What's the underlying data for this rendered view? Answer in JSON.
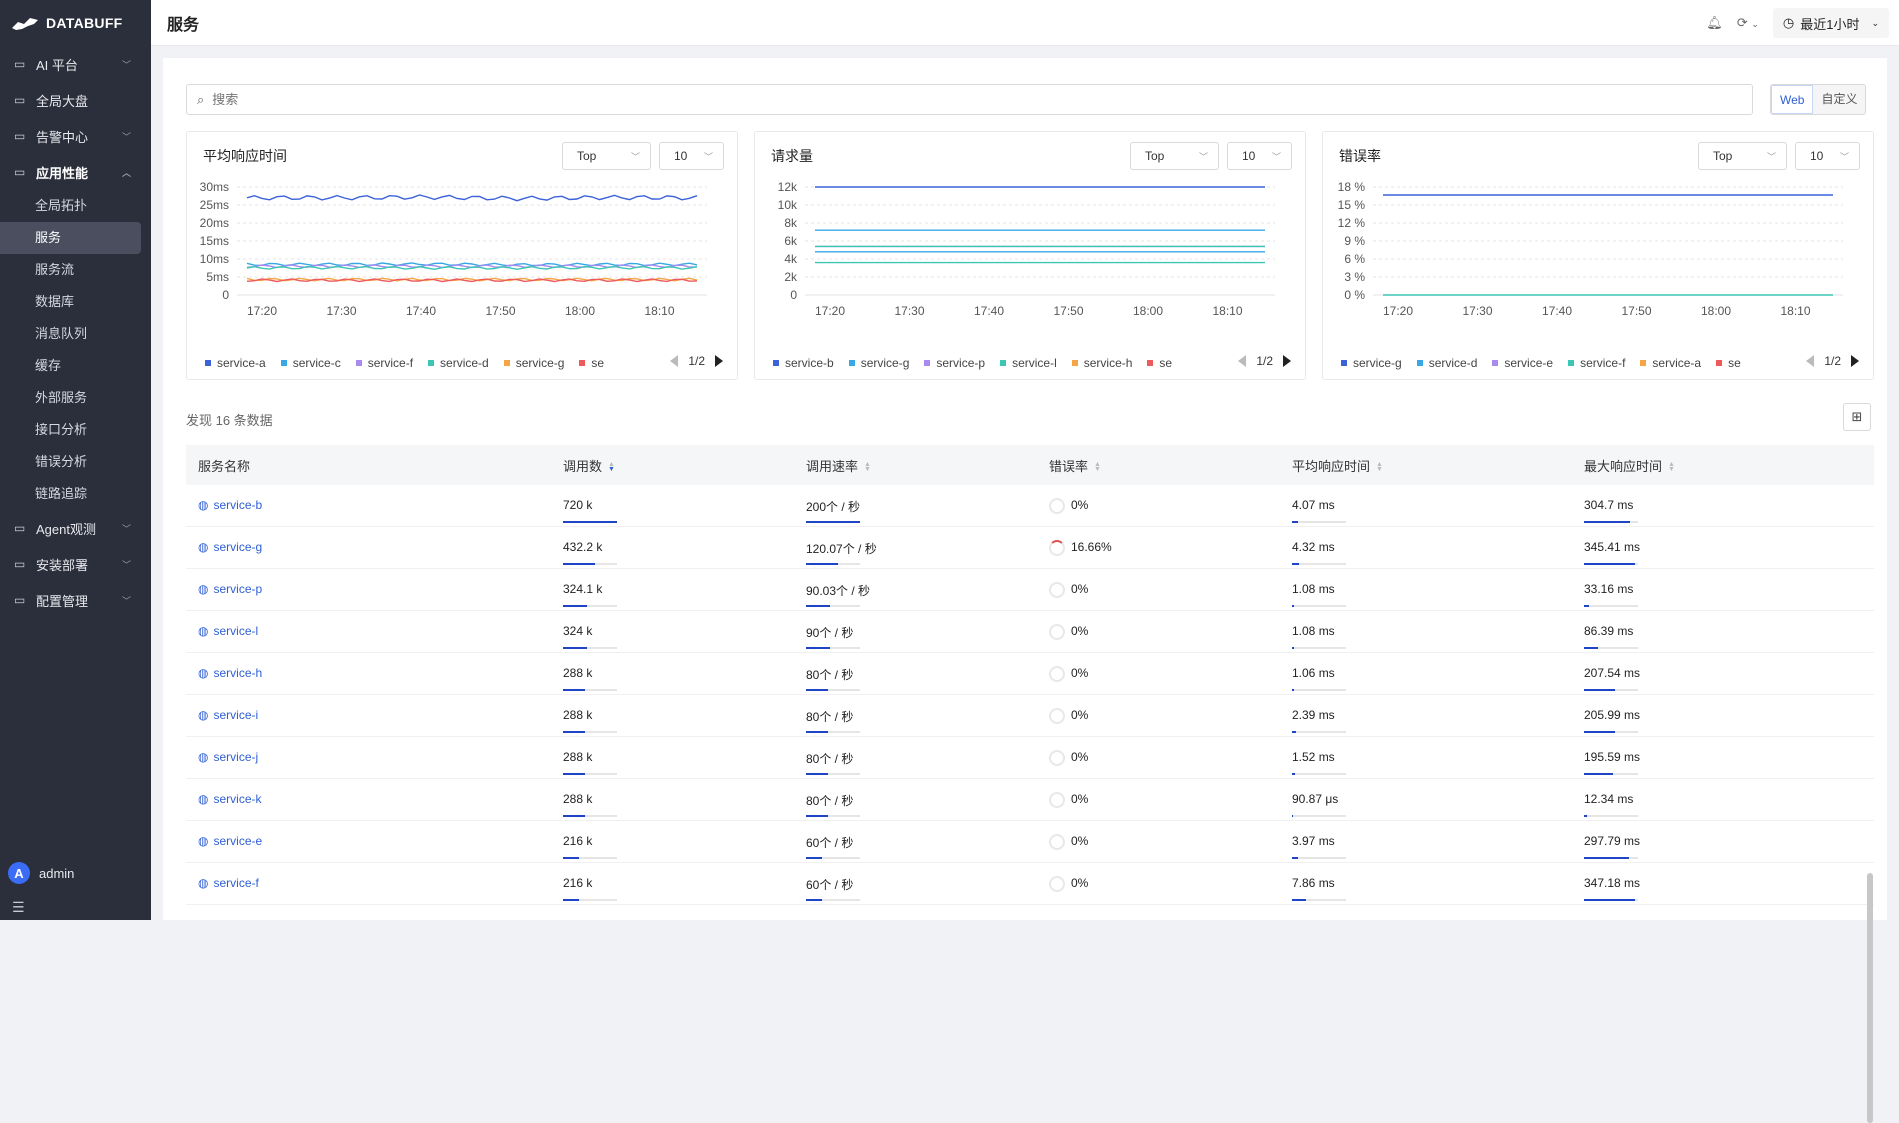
{
  "sidebar": {
    "logo": "DATABUFF",
    "groups": [
      {
        "label": "AI 平台",
        "icon": "ai-platform-icon"
      },
      {
        "label": "全局大盘",
        "icon": "dashboard-icon"
      },
      {
        "label": "告警中心",
        "icon": "alarm-icon"
      },
      {
        "label": "应用性能",
        "icon": "apm-icon"
      }
    ],
    "sub_items": [
      "全局拓扑",
      "服务",
      "服务流",
      "数据库",
      "消息队列",
      "缓存",
      "外部服务",
      "接口分析",
      "错误分析",
      "链路追踪"
    ],
    "selected_sub": "服务",
    "groups_after": [
      {
        "label": "Agent观测",
        "icon": "agent-icon"
      },
      {
        "label": "安装部署",
        "icon": "install-icon"
      },
      {
        "label": "配置管理",
        "icon": "config-icon"
      }
    ],
    "user": {
      "initial": "A",
      "name": "admin"
    }
  },
  "header": {
    "title": "服务",
    "time_range": "最近1小时"
  },
  "search": {
    "placeholder": "搜索"
  },
  "view_toggle": {
    "options": [
      "Web",
      "自定义"
    ],
    "selected": "Web"
  },
  "panels": [
    {
      "title": "平均响应时间",
      "select_top": "Top",
      "select_n": "10",
      "legend": [
        "service-a",
        "service-c",
        "service-f",
        "service-d",
        "service-g",
        "se"
      ],
      "legend_colors": [
        "#3b62d8",
        "#37a7e6",
        "#a98bf0",
        "#3cc6b3",
        "#f5a546",
        "#ee5a5a"
      ],
      "page": "1/2"
    },
    {
      "title": "请求量",
      "select_top": "Top",
      "select_n": "10",
      "legend": [
        "service-b",
        "service-g",
        "service-p",
        "service-l",
        "service-h",
        "se"
      ],
      "legend_colors": [
        "#3b62d8",
        "#37a7e6",
        "#a98bf0",
        "#3cc6b3",
        "#f5a546",
        "#ee5a5a"
      ],
      "page": "1/2"
    },
    {
      "title": "错误率",
      "select_top": "Top",
      "select_n": "10",
      "legend": [
        "service-g",
        "service-d",
        "service-e",
        "service-f",
        "service-a",
        "se"
      ],
      "legend_colors": [
        "#3b62d8",
        "#37a7e6",
        "#a98bf0",
        "#3cc6b3",
        "#f5a546",
        "#ee5a5a"
      ],
      "page": "1/2"
    }
  ],
  "chart_data": [
    {
      "type": "line",
      "title": "平均响应时间",
      "x": [
        "17:20",
        "17:30",
        "17:40",
        "17:50",
        "18:00",
        "18:10"
      ],
      "y_ticks": [
        "0",
        "5ms",
        "10ms",
        "15ms",
        "20ms",
        "25ms",
        "30ms"
      ],
      "ylim": [
        0,
        30
      ],
      "series": [
        {
          "name": "service-a",
          "color": "#3b62d8",
          "values": [
            27,
            27,
            27.2,
            26.8,
            27.1,
            27
          ]
        },
        {
          "name": "service-c",
          "color": "#37a7e6",
          "values": [
            8.5,
            8.5,
            8.6,
            8.4,
            8.5,
            8.5
          ]
        },
        {
          "name": "service-f",
          "color": "#a98bf0",
          "values": [
            8,
            8,
            8,
            8,
            8,
            8
          ]
        },
        {
          "name": "service-d",
          "color": "#3cc6b3",
          "values": [
            7.5,
            7.6,
            7.5,
            7.5,
            7.6,
            7.5
          ]
        },
        {
          "name": "service-g",
          "color": "#f5a546",
          "values": [
            4.3,
            4.3,
            4.3,
            4.3,
            4.3,
            4.3
          ]
        },
        {
          "name": "se",
          "color": "#ee5a5a",
          "values": [
            4.1,
            4.1,
            4.1,
            4.1,
            4.1,
            4.1
          ]
        }
      ]
    },
    {
      "type": "line",
      "title": "请求量",
      "x": [
        "17:20",
        "17:30",
        "17:40",
        "17:50",
        "18:00",
        "18:10"
      ],
      "y_ticks": [
        "0",
        "2k",
        "4k",
        "6k",
        "8k",
        "10k",
        "12k"
      ],
      "ylim": [
        0,
        12000
      ],
      "series": [
        {
          "name": "service-b",
          "color": "#3b62d8",
          "values": [
            12000,
            12000,
            12000,
            12000,
            12000,
            12000
          ]
        },
        {
          "name": "service-g",
          "color": "#37a7e6",
          "values": [
            7200,
            7200,
            7200,
            7200,
            7200,
            7200
          ]
        },
        {
          "name": "service-p",
          "color": "#a98bf0",
          "values": [
            5400,
            5400,
            5400,
            5400,
            5400,
            5400
          ]
        },
        {
          "name": "service-l",
          "color": "#3cc6b3",
          "values": [
            5400,
            5400,
            5400,
            5400,
            5400,
            5400
          ]
        },
        {
          "name": "service-h",
          "color": "#37a7e6",
          "values": [
            4800,
            4800,
            4800,
            4800,
            4800,
            4800
          ]
        },
        {
          "name": "se",
          "color": "#3cc6b3",
          "values": [
            3600,
            3600,
            3600,
            3600,
            3600,
            3600
          ]
        }
      ]
    },
    {
      "type": "line",
      "title": "错误率",
      "x": [
        "17:20",
        "17:30",
        "17:40",
        "17:50",
        "18:00",
        "18:10"
      ],
      "y_ticks": [
        "0 %",
        "3 %",
        "6 %",
        "9 %",
        "12 %",
        "15 %",
        "18 %"
      ],
      "ylim": [
        0,
        18
      ],
      "series": [
        {
          "name": "service-g",
          "color": "#3b62d8",
          "values": [
            16.66,
            16.66,
            16.66,
            16.66,
            16.66,
            16.66
          ]
        },
        {
          "name": "service-d",
          "color": "#3cc6b3",
          "values": [
            0,
            0,
            0,
            0,
            0,
            0
          ]
        }
      ]
    }
  ],
  "table": {
    "summary": "发现 16 条数据",
    "columns": [
      "服务名称",
      "调用数",
      "调用速率",
      "错误率",
      "平均响应时间",
      "最大响应时间"
    ],
    "rows": [
      {
        "name": "service-b",
        "calls": "720 k",
        "calls_pct": 1.0,
        "rate": "200个 / 秒",
        "rate_pct": 1.0,
        "err": "0%",
        "err_pct": 0,
        "avg": "4.07 ms",
        "avg_pct": 0.12,
        "max": "304.7 ms",
        "max_pct": 0.86
      },
      {
        "name": "service-g",
        "calls": "432.2 k",
        "calls_pct": 0.6,
        "rate": "120.07个 / 秒",
        "rate_pct": 0.6,
        "err": "16.66%",
        "err_pct": 0.1666,
        "avg": "4.32 ms",
        "avg_pct": 0.13,
        "max": "345.41 ms",
        "max_pct": 0.95
      },
      {
        "name": "service-p",
        "calls": "324.1 k",
        "calls_pct": 0.45,
        "rate": "90.03个 / 秒",
        "rate_pct": 0.45,
        "err": "0%",
        "err_pct": 0,
        "avg": "1.08 ms",
        "avg_pct": 0.04,
        "max": "33.16 ms",
        "max_pct": 0.1
      },
      {
        "name": "service-l",
        "calls": "324 k",
        "calls_pct": 0.45,
        "rate": "90个 / 秒",
        "rate_pct": 0.45,
        "err": "0%",
        "err_pct": 0,
        "avg": "1.08 ms",
        "avg_pct": 0.04,
        "max": "86.39 ms",
        "max_pct": 0.25
      },
      {
        "name": "service-h",
        "calls": "288 k",
        "calls_pct": 0.4,
        "rate": "80个 / 秒",
        "rate_pct": 0.4,
        "err": "0%",
        "err_pct": 0,
        "avg": "1.06 ms",
        "avg_pct": 0.04,
        "max": "207.54 ms",
        "max_pct": 0.58
      },
      {
        "name": "service-i",
        "calls": "288 k",
        "calls_pct": 0.4,
        "rate": "80个 / 秒",
        "rate_pct": 0.4,
        "err": "0%",
        "err_pct": 0,
        "avg": "2.39 ms",
        "avg_pct": 0.08,
        "max": "205.99 ms",
        "max_pct": 0.57
      },
      {
        "name": "service-j",
        "calls": "288 k",
        "calls_pct": 0.4,
        "rate": "80个 / 秒",
        "rate_pct": 0.4,
        "err": "0%",
        "err_pct": 0,
        "avg": "1.52 ms",
        "avg_pct": 0.05,
        "max": "195.59 ms",
        "max_pct": 0.54
      },
      {
        "name": "service-k",
        "calls": "288 k",
        "calls_pct": 0.4,
        "rate": "80个 / 秒",
        "rate_pct": 0.4,
        "err": "0%",
        "err_pct": 0,
        "avg": "90.87 μs",
        "avg_pct": 0.02,
        "max": "12.34 ms",
        "max_pct": 0.05
      },
      {
        "name": "service-e",
        "calls": "216 k",
        "calls_pct": 0.3,
        "rate": "60个 / 秒",
        "rate_pct": 0.3,
        "err": "0%",
        "err_pct": 0,
        "avg": "3.97 ms",
        "avg_pct": 0.12,
        "max": "297.79 ms",
        "max_pct": 0.84
      },
      {
        "name": "service-f",
        "calls": "216 k",
        "calls_pct": 0.3,
        "rate": "60个 / 秒",
        "rate_pct": 0.3,
        "err": "0%",
        "err_pct": 0,
        "avg": "7.86 ms",
        "avg_pct": 0.25,
        "max": "347.18 ms",
        "max_pct": 0.95
      }
    ]
  }
}
